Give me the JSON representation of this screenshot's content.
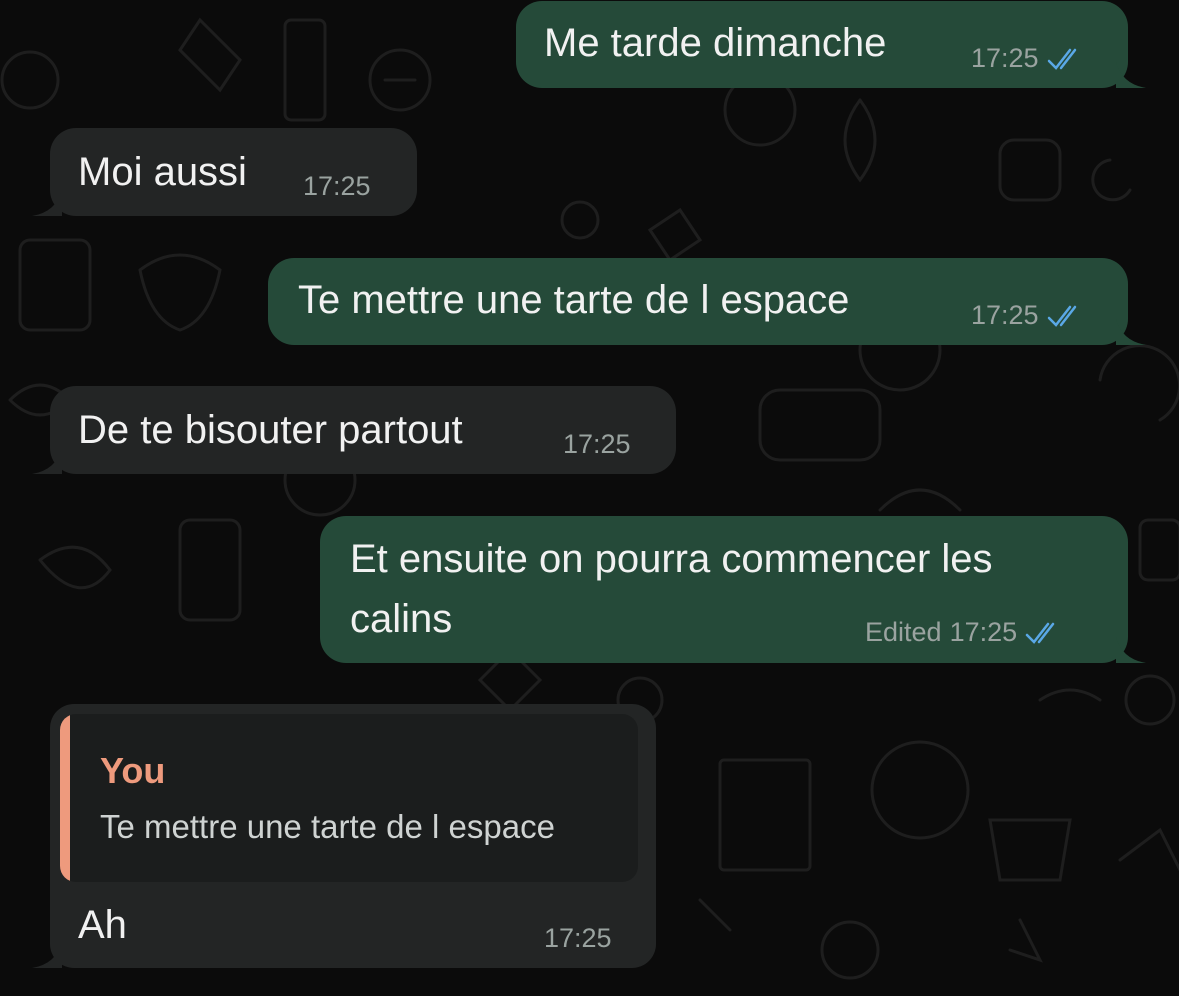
{
  "messages": [
    {
      "text": "Me tarde dimanche",
      "time": "17:25",
      "direction": "outgoing",
      "status": "read"
    },
    {
      "text": "Moi aussi",
      "time": "17:25",
      "direction": "incoming"
    },
    {
      "text": "Te mettre une tarte de l espace",
      "time": "17:25",
      "direction": "outgoing",
      "status": "read"
    },
    {
      "text": "De te bisouter partout",
      "time": "17:25",
      "direction": "incoming"
    },
    {
      "text_line1": "Et ensuite on pourra commencer les",
      "text_line2": "calins",
      "edited_label": "Edited",
      "time": "17:25",
      "direction": "outgoing",
      "status": "read"
    },
    {
      "reply": {
        "author": "You",
        "text": "Te mettre une tarte de l espace"
      },
      "text": "Ah",
      "time": "17:25",
      "direction": "incoming"
    }
  ],
  "colors": {
    "background": "#0b0b0b",
    "outgoing_bubble": "#254a39",
    "incoming_bubble": "#232525",
    "read_ticks": "#5aa8e6",
    "reply_accent": "#ee9a7d"
  }
}
